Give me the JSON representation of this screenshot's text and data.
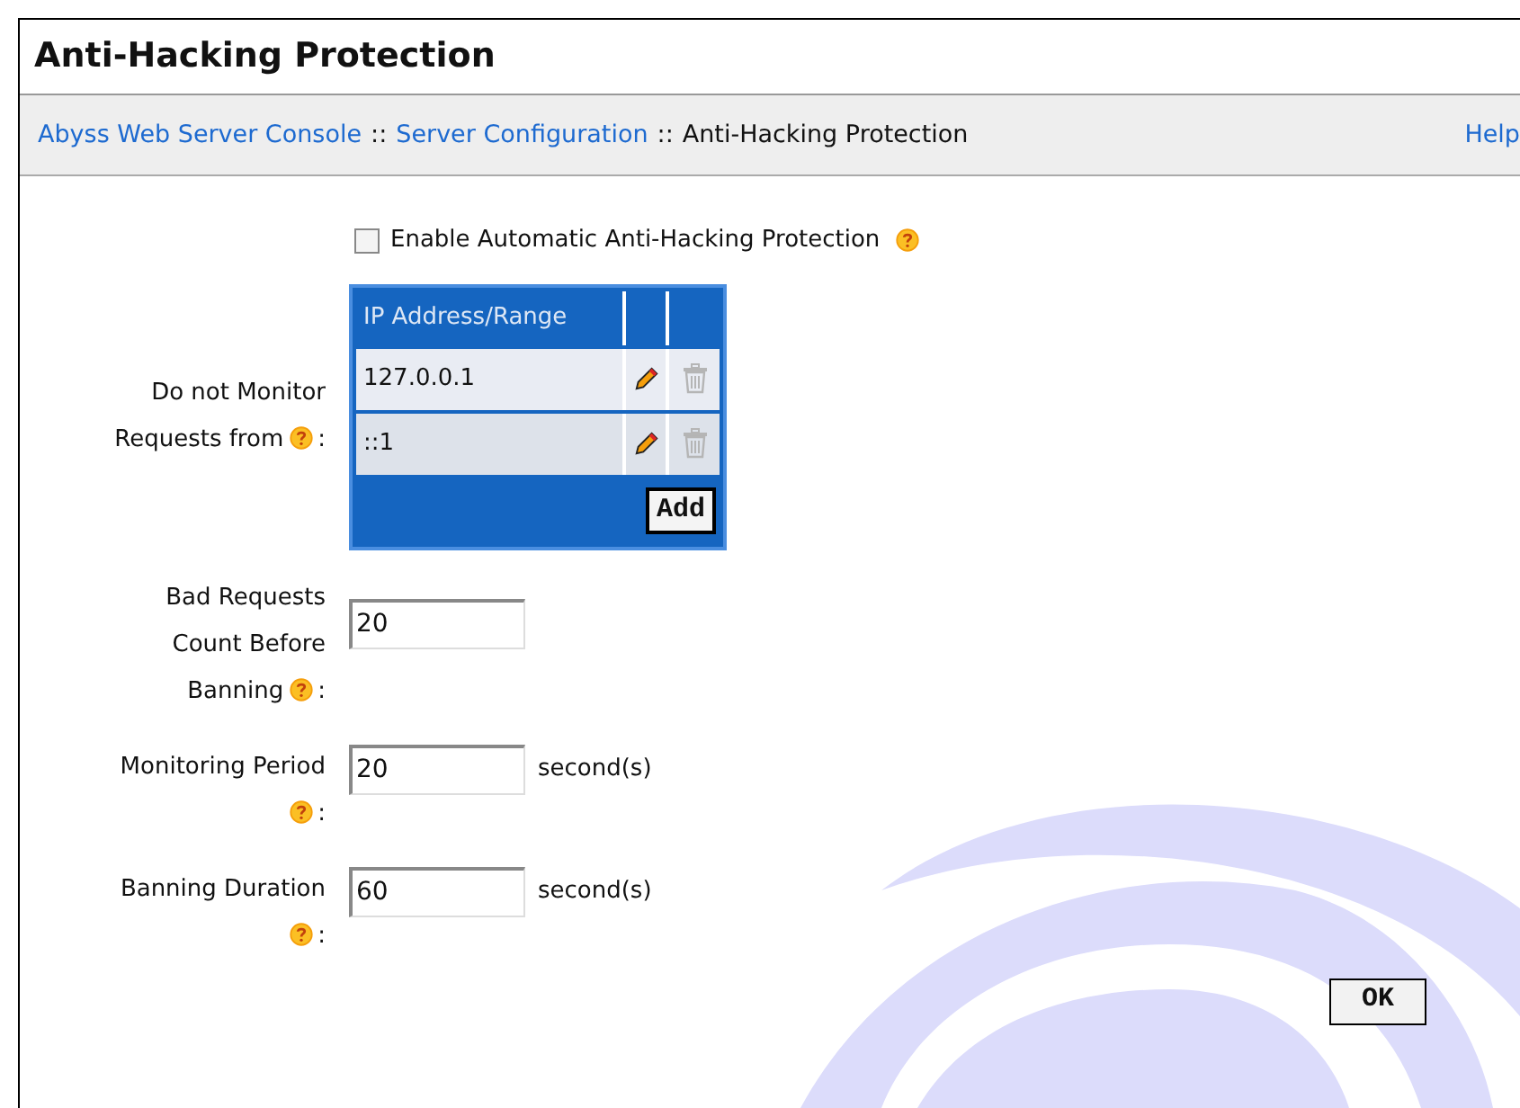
{
  "window": {
    "title": "Anti-Hacking Protection"
  },
  "breadcrumb": [
    {
      "kind": "link",
      "label": "Abyss Web Server Console"
    },
    {
      "kind": "separator",
      "label": "::"
    },
    {
      "kind": "link",
      "label": "Server Configuration"
    },
    {
      "kind": "separator",
      "label": "::"
    },
    {
      "kind": "current",
      "label": "Anti-Hacking Protection"
    }
  ],
  "help_link": "Help",
  "enable": {
    "label": "Enable Automatic Anti-Hacking Protection",
    "checked": false
  },
  "ip_table": {
    "label": "Do not Monitor Requests from",
    "colon": ":",
    "columns": [
      "IP Address/Range"
    ],
    "rows": [
      {
        "address": "127.0.0.1"
      },
      {
        "address": "::1"
      }
    ],
    "add_button": "Add"
  },
  "fields": [
    {
      "label": "Bad Requests Count Before Banning",
      "colon": ":",
      "value": "20"
    },
    {
      "label": "Monitoring Period",
      "colon": ":",
      "value": "20",
      "unit": "second(s)"
    },
    {
      "label": "Banning Duration",
      "colon": ":",
      "value": "60",
      "unit": "second(s)"
    }
  ],
  "ok_button": "OK"
}
